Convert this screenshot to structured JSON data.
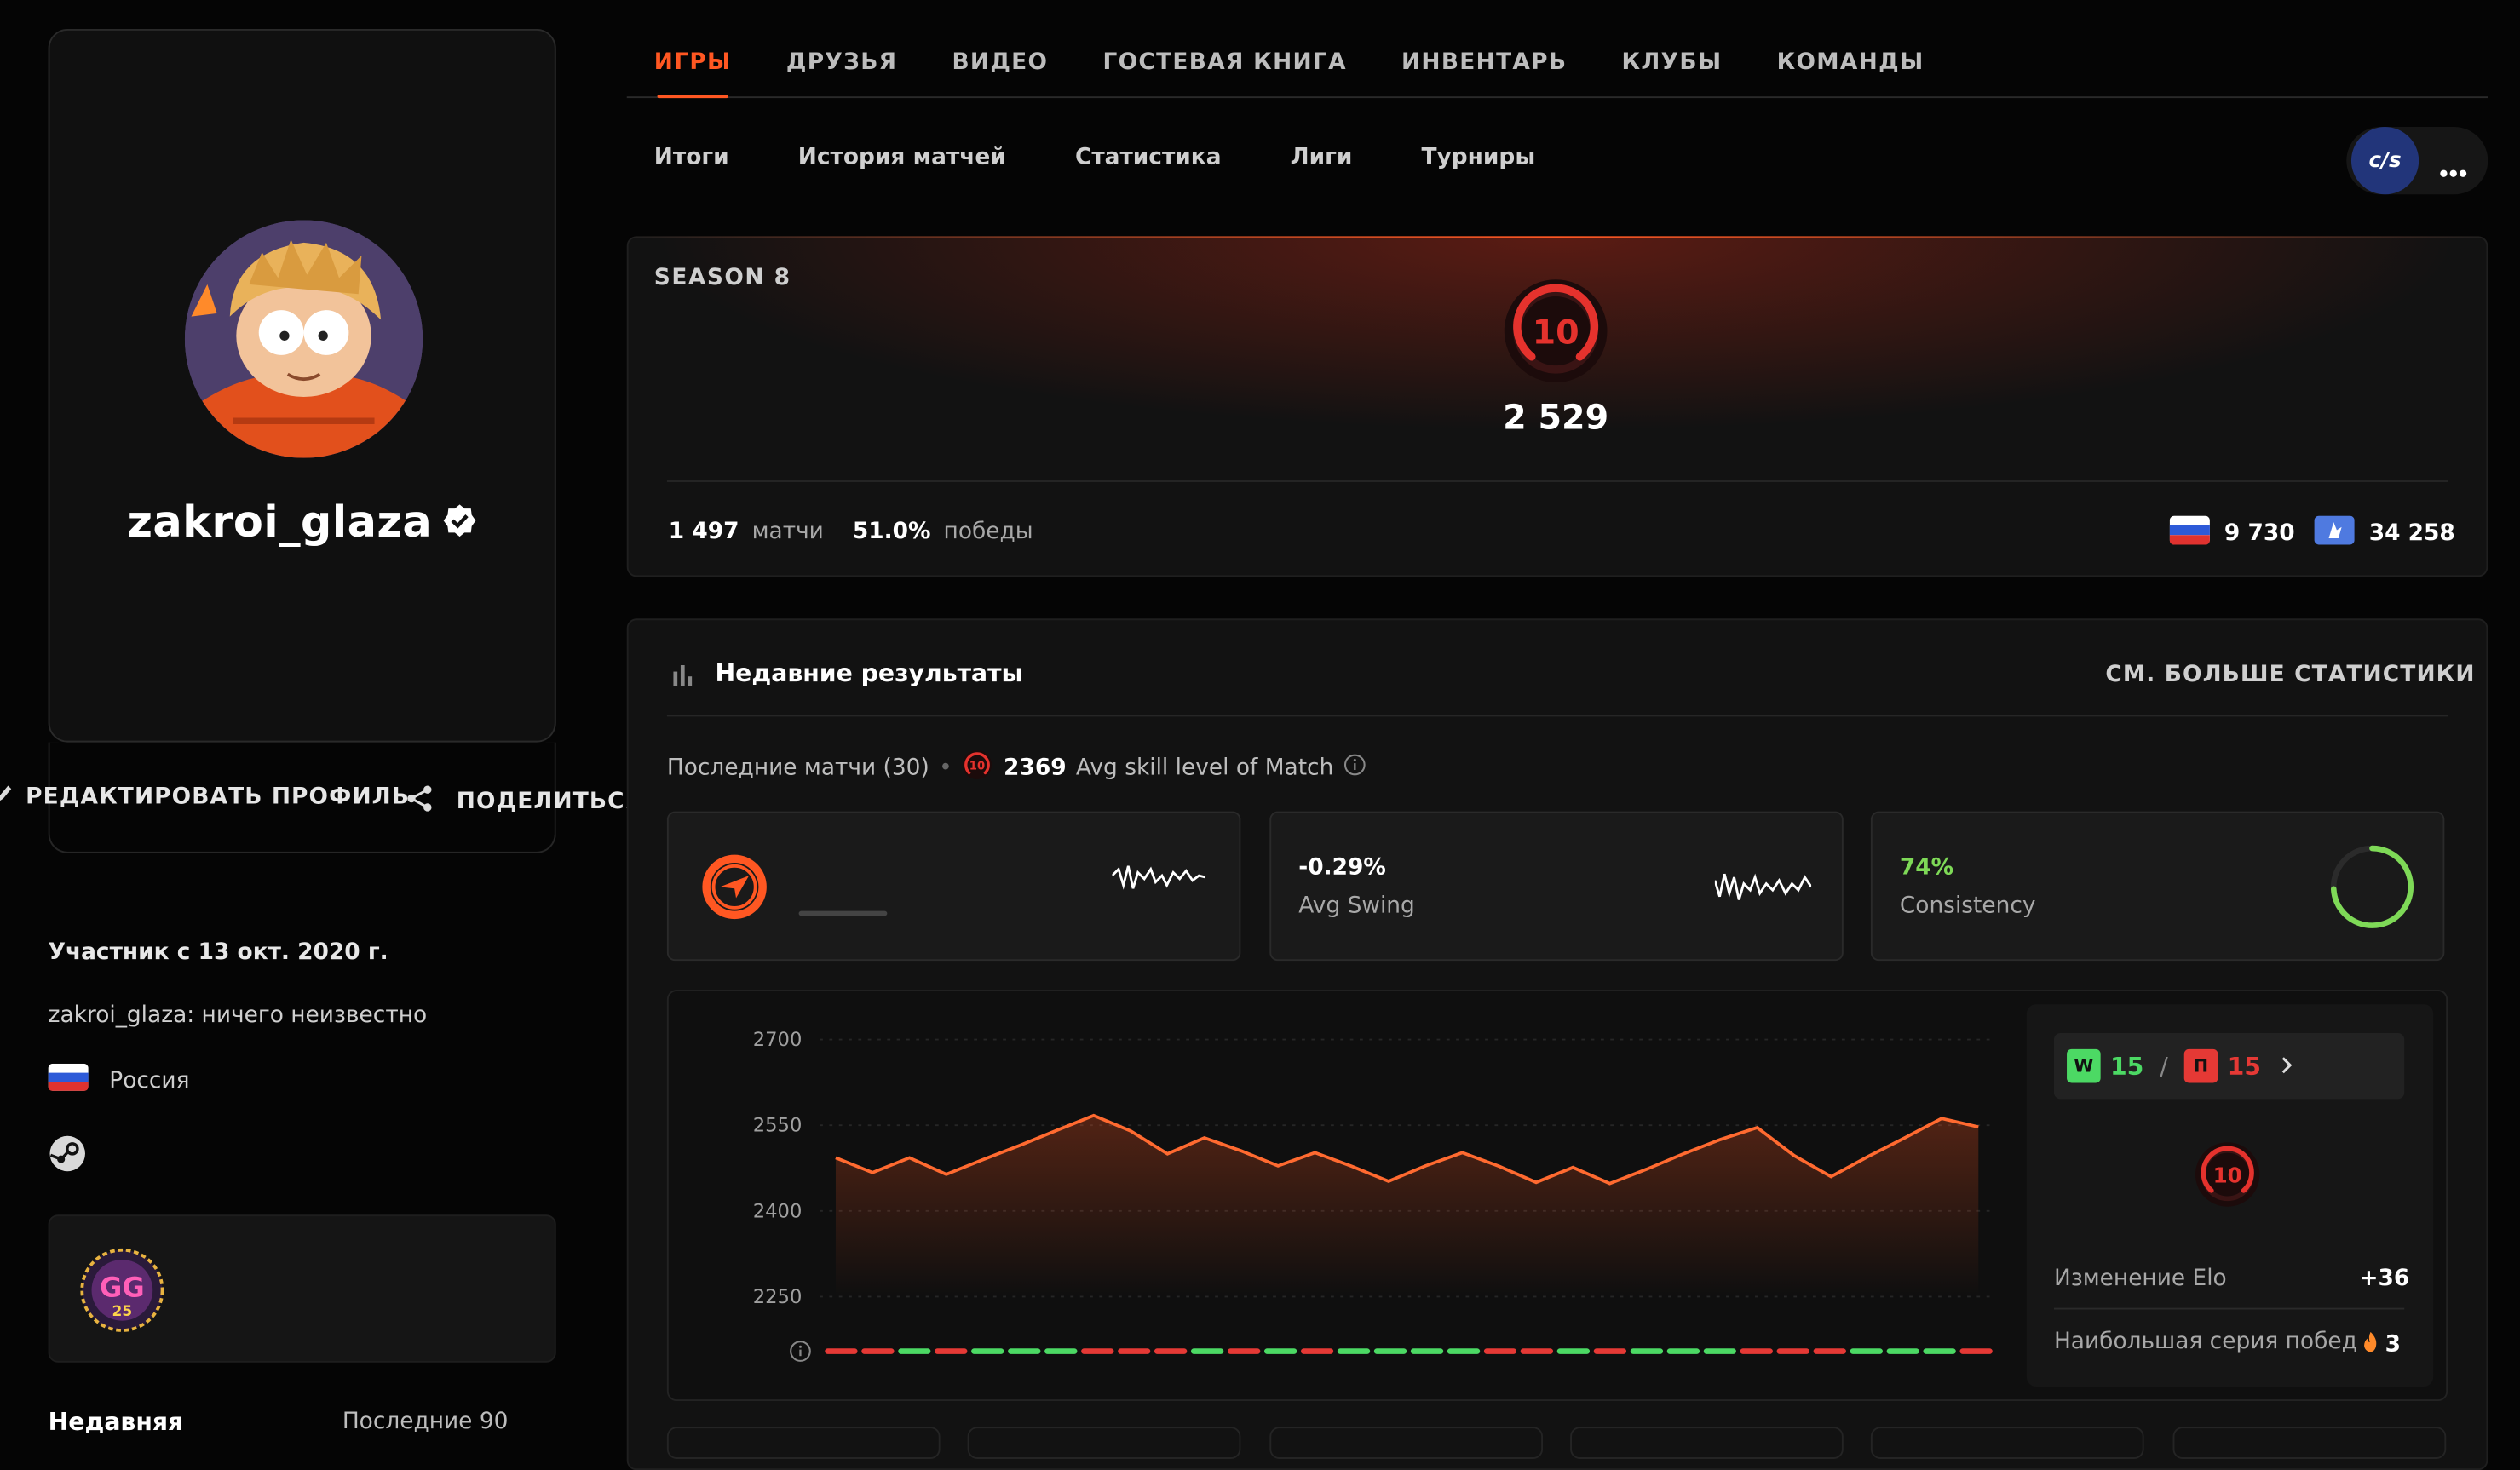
{
  "profile": {
    "username": "zakroi_glaza",
    "edit_label": "РЕДАКТИРОВАТЬ ПРОФИЛЬ",
    "share_label": "ПОДЕЛИТЬСЯ",
    "member_since": "Участник с 13 окт. 2020 г.",
    "bio": "zakroi_glaza: ничего неизвестно",
    "country": "Россия",
    "badge_text": "GG",
    "badge_number": "25",
    "recent_label": "Недавняя",
    "recent_period": "Последние 90"
  },
  "tabs": [
    {
      "label": "ИГРЫ",
      "active": true
    },
    {
      "label": "ДРУЗЬЯ"
    },
    {
      "label": "ВИДЕО"
    },
    {
      "label": "ГОСТЕВАЯ КНИГА"
    },
    {
      "label": "ИНВЕНТАРЬ"
    },
    {
      "label": "КЛУБЫ"
    },
    {
      "label": "КОМАНДЫ"
    }
  ],
  "subtabs": [
    "Итоги",
    "История матчей",
    "Статистика",
    "Лиги",
    "Турниры"
  ],
  "game_badge": "c/s",
  "season": {
    "title": "SEASON 8",
    "level": "10",
    "elo": "2 529",
    "matches_value": "1 497",
    "matches_label": "матчи",
    "winrate_value": "51.0%",
    "winrate_label": "победы",
    "country_rank": "9 730",
    "region_rank": "34 258"
  },
  "recent": {
    "title": "Недавние результаты",
    "more_label": "СМ. БОЛЬШЕ СТАТИСТИКИ",
    "last_matches": "Последние матчи (30)",
    "avg_level": "10",
    "avg_skill_value": "2369",
    "avg_skill_label": "Avg skill level of Match",
    "swing_value": "-0.29%",
    "swing_label": "Avg Swing",
    "consistency_value": "74%",
    "consistency_label": "Consistency",
    "consistency_fraction": 0.74,
    "wins": "15",
    "losses": "15",
    "win_letter": "W",
    "loss_letter": "П",
    "side_level": "10",
    "elo_change_label": "Изменение Elo",
    "elo_change_value": "+36",
    "streak_label": "Наибольшая серия побед",
    "streak_value": "3"
  },
  "colors": {
    "accent": "#ff5722",
    "win": "#4cd964",
    "loss": "#e53935",
    "consistency": "#7ed957"
  },
  "chart_data": {
    "type": "line",
    "yticks": [
      "2700",
      "2550",
      "2400",
      "2250"
    ],
    "ylim": [
      2250,
      2700
    ],
    "values": [
      2493,
      2467,
      2493,
      2464,
      2490,
      2515,
      2541,
      2567,
      2540,
      2500,
      2528,
      2505,
      2479,
      2502,
      2478,
      2452,
      2479,
      2502,
      2478,
      2450,
      2476,
      2448,
      2473,
      2500,
      2525,
      2546,
      2497,
      2460,
      2495,
      2528,
      2562,
      2547
    ],
    "results": [
      "L",
      "L",
      "W",
      "L",
      "W",
      "W",
      "W",
      "L",
      "L",
      "L",
      "W",
      "L",
      "W",
      "L",
      "W",
      "W",
      "W",
      "W",
      "L",
      "L",
      "W",
      "L",
      "W",
      "W",
      "W",
      "L",
      "L",
      "L",
      "W",
      "W",
      "W",
      "L"
    ]
  }
}
